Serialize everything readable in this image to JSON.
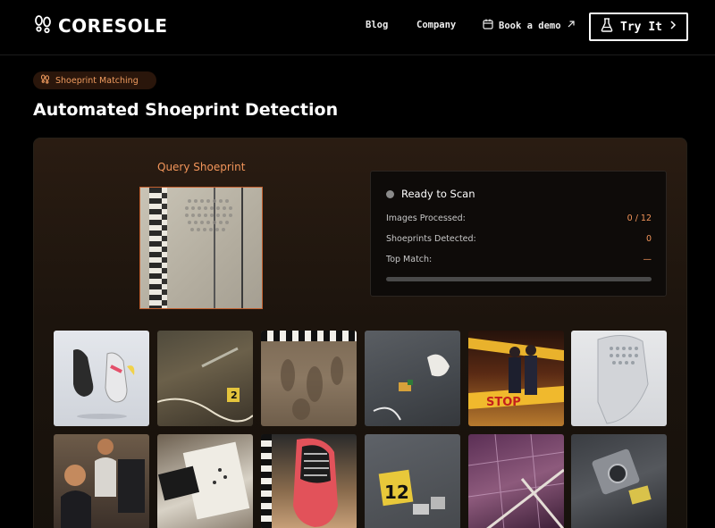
{
  "header": {
    "brand": "CORESOLE",
    "nav": {
      "blog": "Blog",
      "company": "Company",
      "demo": "Book a demo"
    },
    "cta": "Try It"
  },
  "badge": {
    "label": "Shoeprint Matching"
  },
  "page_title": "Automated Shoeprint Detection",
  "query": {
    "label": "Query Shoeprint"
  },
  "status": {
    "title": "Ready to Scan",
    "rows": [
      {
        "label": "Images Processed:",
        "value": "0 / 12"
      },
      {
        "label": "Shoeprints Detected:",
        "value": "0"
      },
      {
        "label": "Top Match:",
        "value": "—"
      }
    ],
    "progress": 0
  },
  "gallery": {
    "markers": {
      "t2": "2",
      "t10": "12"
    },
    "stop_text": "STOP"
  },
  "colors": {
    "accent": "#f2955a",
    "background": "#000000",
    "badge_bg": "#2a160b"
  },
  "icons": {
    "logo": "footprints-icon",
    "demo": "calendar-icon",
    "external": "arrow-up-right-icon",
    "cta": "flask-icon",
    "chevron": "chevron-right-icon",
    "badge": "footprints-icon",
    "status": "status-dot-icon"
  }
}
